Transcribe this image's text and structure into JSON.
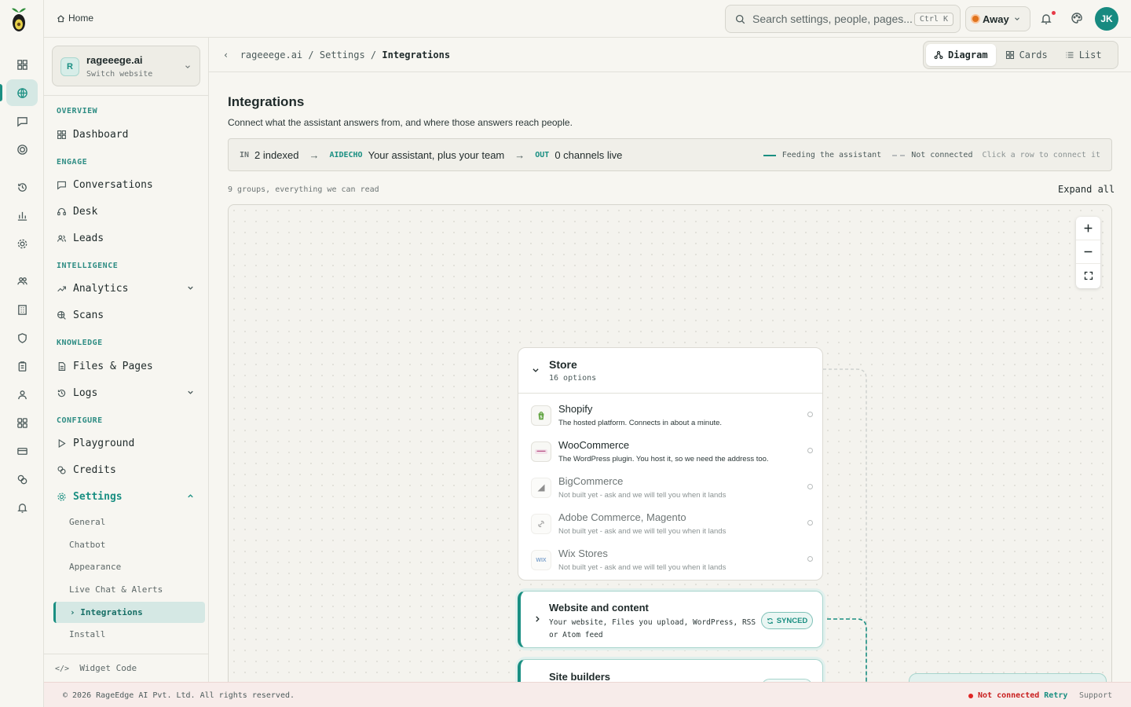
{
  "topbar": {
    "home_label": "Home",
    "search_placeholder": "Search settings, people, pages...",
    "search_shortcut": "Ctrl K",
    "status_label": "Away",
    "avatar_initials": "JK"
  },
  "rail": {
    "icons": [
      "logo-icon",
      "grid-icon",
      "globe-icon",
      "chat-icon",
      "target-icon",
      "history-icon",
      "bar-chart-icon",
      "gear-icon",
      "team-icon",
      "building-icon",
      "shield-icon",
      "clipboard-icon",
      "user-icon",
      "apps-icon",
      "card-icon",
      "coins-icon",
      "bell-icon"
    ],
    "active": "globe-icon"
  },
  "sidebar": {
    "site": {
      "initial": "R",
      "name": "rageeege.ai",
      "sub": "Switch website"
    },
    "sections": {
      "overview": "OVERVIEW",
      "engage": "ENGAGE",
      "intelligence": "INTELLIGENCE",
      "knowledge": "KNOWLEDGE",
      "configure": "CONFIGURE"
    },
    "items": {
      "dashboard": "Dashboard",
      "conversations": "Conversations",
      "desk": "Desk",
      "leads": "Leads",
      "analytics": "Analytics",
      "scans": "Scans",
      "files": "Files & Pages",
      "logs": "Logs",
      "playground": "Playground",
      "credits": "Credits",
      "settings": "Settings"
    },
    "settings_sub": {
      "general": "General",
      "chatbot": "Chatbot",
      "appearance": "Appearance",
      "live_chat": "Live Chat & Alerts",
      "integrations": "Integrations",
      "install": "Install"
    },
    "integrations_marker": "›",
    "widget_code": "Widget Code"
  },
  "breadcrumb": {
    "root": "rageeege.ai",
    "sep": "/",
    "mid": "Settings",
    "current": "Integrations"
  },
  "views": {
    "diagram": "Diagram",
    "cards": "Cards",
    "list": "List",
    "active": "diagram"
  },
  "page": {
    "title": "Integrations",
    "description": "Connect what the assistant answers from, and where those answers reach people."
  },
  "flow": {
    "in_tag": "IN",
    "in_text": "2 indexed",
    "hub_tag": "AIDECHO",
    "hub_text": "Your assistant, plus your team",
    "out_tag": "OUT",
    "out_text": "0 channels live",
    "legend_feeding": "Feeding the assistant",
    "legend_not_connected": "Not connected",
    "hint": "Click a row to connect it"
  },
  "groups_note": "9 groups, everything we can read",
  "expand_all": "Expand all",
  "store": {
    "title": "Store",
    "count": "16 options",
    "options": [
      {
        "name": "Shopify",
        "desc": "The hosted platform. Connects in about a minute.",
        "icon": "shopify-icon",
        "available": true
      },
      {
        "name": "WooCommerce",
        "desc": "The WordPress plugin. You host it, so we need the address too.",
        "icon": "woocommerce-icon",
        "available": true
      },
      {
        "name": "BigCommerce",
        "desc": "Not built yet - ask and we will tell you when it lands",
        "icon": "bigcommerce-icon",
        "available": false
      },
      {
        "name": "Adobe Commerce, Magento",
        "desc": "Not built yet - ask and we will tell you when it lands",
        "icon": "magento-icon",
        "available": false
      },
      {
        "name": "Wix Stores",
        "desc": "Not built yet - ask and we will tell you when it lands",
        "icon": "wix-icon",
        "available": false
      }
    ]
  },
  "website_group": {
    "title": "Website and content",
    "desc": "Your website, Files you upload, WordPress, RSS or Atom feed",
    "status": "SYNCED"
  },
  "site_builders_group": {
    "title": "Site builders"
  },
  "footer": {
    "copyright": "© 2026 RageEdge AI Pvt. Ltd. All rights reserved.",
    "connection": "Not connected",
    "retry": "Retry",
    "support": "Support"
  },
  "colors": {
    "accent": "#1a8f82",
    "error": "#c81e1e",
    "away": "#e0731c"
  }
}
